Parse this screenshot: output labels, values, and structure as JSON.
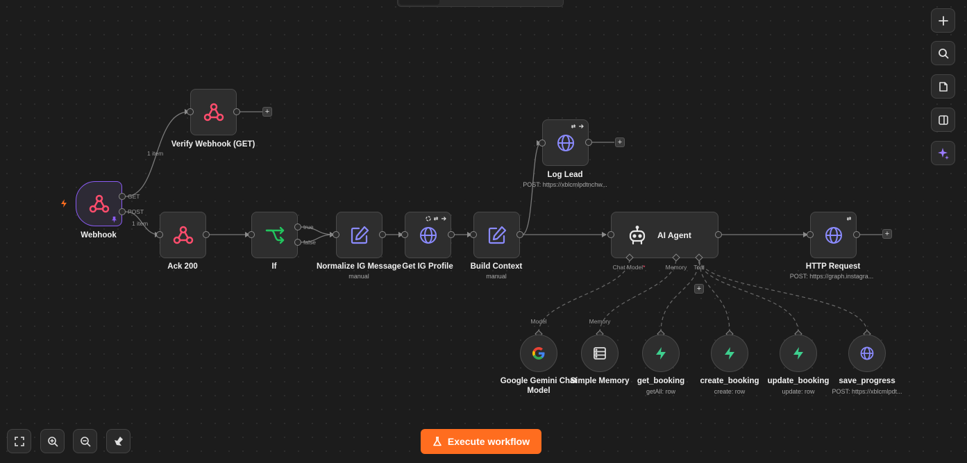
{
  "canvas": {
    "edge_labels": {
      "get_items": "1 item",
      "post_items": "1 item",
      "get_port": "GET",
      "post_port": "POST",
      "if_true": "true",
      "if_false": "false"
    }
  },
  "nodes": {
    "webhook": {
      "label": "Webhook",
      "icon": "webhook-icon"
    },
    "verify_webhook": {
      "label": "Verify Webhook (GET)",
      "icon": "webhook-icon"
    },
    "ack": {
      "label": "Ack 200",
      "icon": "webhook-icon"
    },
    "if": {
      "label": "If",
      "icon": "branch-icon"
    },
    "normalize": {
      "label": "Normalize IG Message",
      "sublabel": "manual",
      "icon": "edit-icon"
    },
    "get_profile": {
      "label": "Get IG Profile",
      "icon": "globe-icon"
    },
    "build_context": {
      "label": "Build Context",
      "sublabel": "manual",
      "icon": "edit-icon"
    },
    "log_lead": {
      "label": "Log Lead",
      "sublabel": "POST: https://xblcmlpdtnchw...",
      "icon": "globe-icon"
    },
    "ai_agent": {
      "label": "AI Agent",
      "icon": "robot-icon",
      "ports": {
        "chat_model": "Chat Model",
        "memory": "Memory",
        "tool": "Tool"
      }
    },
    "http_request": {
      "label": "HTTP Request",
      "sublabel": "POST: https://graph.instagra...",
      "icon": "globe-icon"
    },
    "gemini": {
      "label": "Google Gemini Chat Model",
      "port": "Model",
      "icon": "google-icon"
    },
    "simple_memory": {
      "label": "Simple Memory",
      "port": "Memory",
      "icon": "database-icon"
    },
    "get_booking": {
      "label": "get_booking",
      "sublabel": "getAll: row",
      "icon": "supabase-icon"
    },
    "create_booking": {
      "label": "create_booking",
      "sublabel": "create: row",
      "icon": "supabase-icon"
    },
    "update_booking": {
      "label": "update_booking",
      "sublabel": "update: row",
      "icon": "supabase-icon"
    },
    "save_progress": {
      "label": "save_progress",
      "sublabel": "POST: https://xblcmlpdt...",
      "icon": "globe-icon"
    }
  },
  "toolbar_right": [
    "plus-icon",
    "search-icon",
    "sticky-note-icon",
    "panel-icon",
    "sparkle-icon"
  ],
  "toolbar_bottom": [
    "fit-view-icon",
    "zoom-in-icon",
    "zoom-out-icon",
    "tidy-up-icon"
  ],
  "execute_button": {
    "label": "Execute workflow",
    "icon": "flask-icon",
    "color": "#ff6d1f"
  },
  "colors": {
    "canvas_bg": "#1c1c1c",
    "node_bg": "#2e2e2e",
    "trigger_border": "#8b5cf6",
    "webhook_icon": "#ff4d6d",
    "if_icon": "#22c55e",
    "edit_icon": "#8b8bff",
    "globe_icon": "#8b8bff",
    "supabase_icon": "#3ecf8e"
  }
}
